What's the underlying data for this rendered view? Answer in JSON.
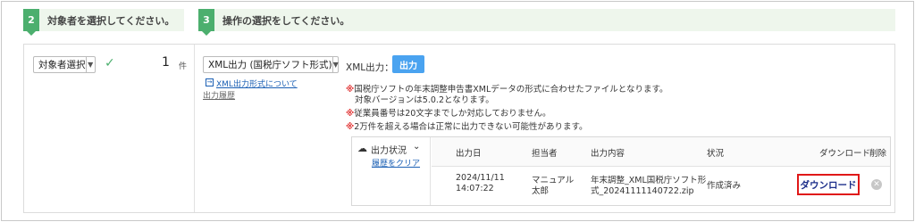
{
  "steps": [
    {
      "num": "2",
      "text": "対象者を選択してください。"
    },
    {
      "num": "3",
      "text": "操作の選択をしてください。"
    }
  ],
  "target": {
    "select_label": "対象者選択",
    "count": "1",
    "count_unit": "件"
  },
  "operation": {
    "select_label": "XML出力 (国税庁ソフト形式)",
    "format_link": "XML出力形式について",
    "history_link": "出力履歴"
  },
  "xml_output": {
    "label": "XML出力：",
    "button": "出力"
  },
  "notes": [
    "国税庁ソフトの年末調整申告書XMLデータの形式に合わせたファイルとなります。",
    "対象バージョンは5.0.2となります。",
    "従業員番号は20文字までしか対応しておりません。",
    "2万件を超える場合は正常に出力できない可能性があります。"
  ],
  "note_mark": "※",
  "history": {
    "status_label": "出力状況",
    "clear_link": "履歴をクリア",
    "columns": [
      "出力日",
      "担当者",
      "出力内容",
      "状況",
      "ダウンロード",
      "削除"
    ],
    "row": {
      "date_line1": "2024/11/11",
      "date_line2": "14:07:22",
      "person_line1": "マニュアル",
      "person_line2": "太郎",
      "content_line1": "年末調整_XML国税庁ソフト形",
      "content_line2": "式_20241111140722.zip",
      "status": "作成済み",
      "download": "ダウンロード"
    }
  },
  "colors": {
    "step_green": "#4caf6e",
    "output_button": "#4aa3f0",
    "download_highlight": "#e01818",
    "note_mark": "#e23c3c"
  }
}
